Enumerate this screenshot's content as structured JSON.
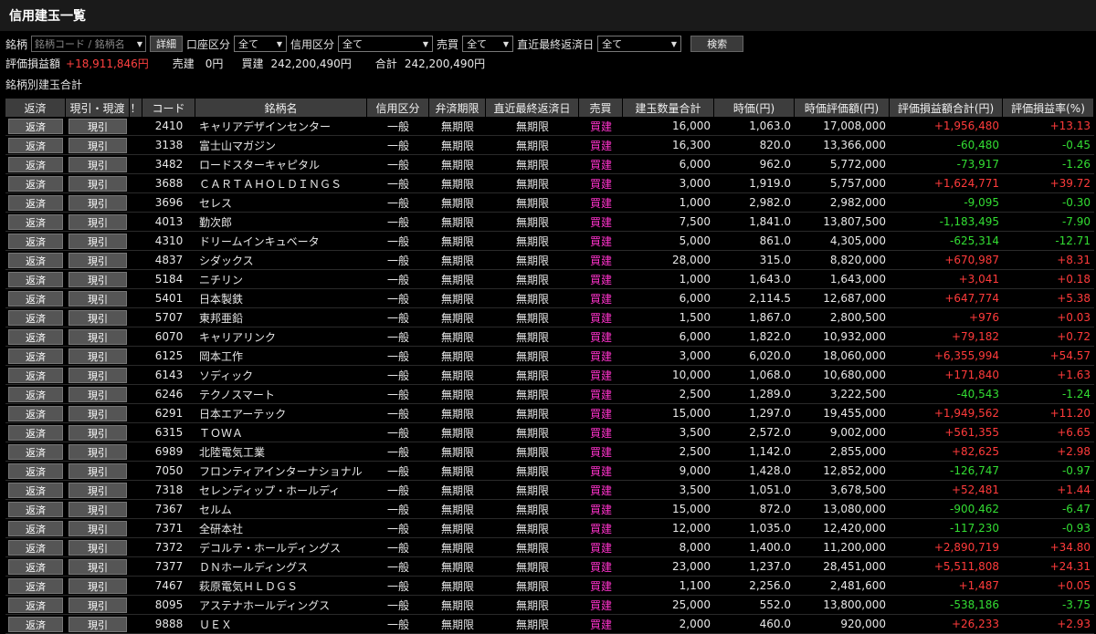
{
  "window": {
    "title": "信用建玉一覧"
  },
  "filters": {
    "meigara_label": "銘柄",
    "meigara_placeholder": "銘柄コード / 銘柄名",
    "detail_button": "詳細",
    "account_label": "口座区分",
    "account_value": "全て",
    "credit_label": "信用区分",
    "credit_value": "全て",
    "trade_label": "売買",
    "trade_value": "全て",
    "due_label": "直近最終返済日",
    "due_value": "全て",
    "search_button": "検索"
  },
  "summary": {
    "pl_label": "評価損益額",
    "pl_value": "+18,911,846円",
    "sell_label": "売建",
    "sell_value": "0円",
    "buy_label": "買建",
    "buy_value": "242,200,490円",
    "total_label": "合計",
    "total_value": "242,200,490円"
  },
  "section": {
    "title": "銘柄別建玉合計"
  },
  "table": {
    "headers": {
      "hensai": "返済",
      "genbiki": "現引・現渡",
      "mark": "！",
      "code": "コード",
      "name": "銘柄名",
      "kubun": "信用区分",
      "kigen": "弁済期限",
      "due": "直近最終返済日",
      "side": "売買",
      "qty": "建玉数量合計",
      "price": "時価(円)",
      "value": "時価評価額(円)",
      "pl": "評価損益額合計(円)",
      "rate": "評価損益率(%)"
    },
    "hensai_label": "返済",
    "genbiki_label": "現引",
    "rows": [
      {
        "code": "2410",
        "name": "キャリアデザインセンター",
        "kubun": "一般",
        "kigen": "無期限",
        "due": "無期限",
        "side": "買建",
        "qty": "16,000",
        "price": "1,063.0",
        "value": "17,008,000",
        "pl": "+1,956,480",
        "rate": "+13.13"
      },
      {
        "code": "3138",
        "name": "富士山マガジン",
        "kubun": "一般",
        "kigen": "無期限",
        "due": "無期限",
        "side": "買建",
        "qty": "16,300",
        "price": "820.0",
        "value": "13,366,000",
        "pl": "-60,480",
        "rate": "-0.45"
      },
      {
        "code": "3482",
        "name": "ロードスターキャピタル",
        "kubun": "一般",
        "kigen": "無期限",
        "due": "無期限",
        "side": "買建",
        "qty": "6,000",
        "price": "962.0",
        "value": "5,772,000",
        "pl": "-73,917",
        "rate": "-1.26"
      },
      {
        "code": "3688",
        "name": "ＣＡＲＴＡＨＯＬＤＩＮＧＳ",
        "kubun": "一般",
        "kigen": "無期限",
        "due": "無期限",
        "side": "買建",
        "qty": "3,000",
        "price": "1,919.0",
        "value": "5,757,000",
        "pl": "+1,624,771",
        "rate": "+39.72"
      },
      {
        "code": "3696",
        "name": "セレス",
        "kubun": "一般",
        "kigen": "無期限",
        "due": "無期限",
        "side": "買建",
        "qty": "1,000",
        "price": "2,982.0",
        "value": "2,982,000",
        "pl": "-9,095",
        "rate": "-0.30"
      },
      {
        "code": "4013",
        "name": "勤次郎",
        "kubun": "一般",
        "kigen": "無期限",
        "due": "無期限",
        "side": "買建",
        "qty": "7,500",
        "price": "1,841.0",
        "value": "13,807,500",
        "pl": "-1,183,495",
        "rate": "-7.90"
      },
      {
        "code": "4310",
        "name": "ドリームインキュベータ",
        "kubun": "一般",
        "kigen": "無期限",
        "due": "無期限",
        "side": "買建",
        "qty": "5,000",
        "price": "861.0",
        "value": "4,305,000",
        "pl": "-625,314",
        "rate": "-12.71"
      },
      {
        "code": "4837",
        "name": "シダックス",
        "kubun": "一般",
        "kigen": "無期限",
        "due": "無期限",
        "side": "買建",
        "qty": "28,000",
        "price": "315.0",
        "value": "8,820,000",
        "pl": "+670,987",
        "rate": "+8.31"
      },
      {
        "code": "5184",
        "name": "ニチリン",
        "kubun": "一般",
        "kigen": "無期限",
        "due": "無期限",
        "side": "買建",
        "qty": "1,000",
        "price": "1,643.0",
        "value": "1,643,000",
        "pl": "+3,041",
        "rate": "+0.18"
      },
      {
        "code": "5401",
        "name": "日本製鉄",
        "kubun": "一般",
        "kigen": "無期限",
        "due": "無期限",
        "side": "買建",
        "qty": "6,000",
        "price": "2,114.5",
        "value": "12,687,000",
        "pl": "+647,774",
        "rate": "+5.38"
      },
      {
        "code": "5707",
        "name": "東邦亜鉛",
        "kubun": "一般",
        "kigen": "無期限",
        "due": "無期限",
        "side": "買建",
        "qty": "1,500",
        "price": "1,867.0",
        "value": "2,800,500",
        "pl": "+976",
        "rate": "+0.03"
      },
      {
        "code": "6070",
        "name": "キャリアリンク",
        "kubun": "一般",
        "kigen": "無期限",
        "due": "無期限",
        "side": "買建",
        "qty": "6,000",
        "price": "1,822.0",
        "value": "10,932,000",
        "pl": "+79,182",
        "rate": "+0.72"
      },
      {
        "code": "6125",
        "name": "岡本工作",
        "kubun": "一般",
        "kigen": "無期限",
        "due": "無期限",
        "side": "買建",
        "qty": "3,000",
        "price": "6,020.0",
        "value": "18,060,000",
        "pl": "+6,355,994",
        "rate": "+54.57"
      },
      {
        "code": "6143",
        "name": "ソディック",
        "kubun": "一般",
        "kigen": "無期限",
        "due": "無期限",
        "side": "買建",
        "qty": "10,000",
        "price": "1,068.0",
        "value": "10,680,000",
        "pl": "+171,840",
        "rate": "+1.63"
      },
      {
        "code": "6246",
        "name": "テクノスマート",
        "kubun": "一般",
        "kigen": "無期限",
        "due": "無期限",
        "side": "買建",
        "qty": "2,500",
        "price": "1,289.0",
        "value": "3,222,500",
        "pl": "-40,543",
        "rate": "-1.24"
      },
      {
        "code": "6291",
        "name": "日本エアーテック",
        "kubun": "一般",
        "kigen": "無期限",
        "due": "無期限",
        "side": "買建",
        "qty": "15,000",
        "price": "1,297.0",
        "value": "19,455,000",
        "pl": "+1,949,562",
        "rate": "+11.20"
      },
      {
        "code": "6315",
        "name": "ＴＯＷＡ",
        "kubun": "一般",
        "kigen": "無期限",
        "due": "無期限",
        "side": "買建",
        "qty": "3,500",
        "price": "2,572.0",
        "value": "9,002,000",
        "pl": "+561,355",
        "rate": "+6.65"
      },
      {
        "code": "6989",
        "name": "北陸電気工業",
        "kubun": "一般",
        "kigen": "無期限",
        "due": "無期限",
        "side": "買建",
        "qty": "2,500",
        "price": "1,142.0",
        "value": "2,855,000",
        "pl": "+82,625",
        "rate": "+2.98"
      },
      {
        "code": "7050",
        "name": "フロンティアインターナショナル",
        "kubun": "一般",
        "kigen": "無期限",
        "due": "無期限",
        "side": "買建",
        "qty": "9,000",
        "price": "1,428.0",
        "value": "12,852,000",
        "pl": "-126,747",
        "rate": "-0.97"
      },
      {
        "code": "7318",
        "name": "セレンディップ・ホールディ",
        "kubun": "一般",
        "kigen": "無期限",
        "due": "無期限",
        "side": "買建",
        "qty": "3,500",
        "price": "1,051.0",
        "value": "3,678,500",
        "pl": "+52,481",
        "rate": "+1.44"
      },
      {
        "code": "7367",
        "name": "セルム",
        "kubun": "一般",
        "kigen": "無期限",
        "due": "無期限",
        "side": "買建",
        "qty": "15,000",
        "price": "872.0",
        "value": "13,080,000",
        "pl": "-900,462",
        "rate": "-6.47"
      },
      {
        "code": "7371",
        "name": "全研本社",
        "kubun": "一般",
        "kigen": "無期限",
        "due": "無期限",
        "side": "買建",
        "qty": "12,000",
        "price": "1,035.0",
        "value": "12,420,000",
        "pl": "-117,230",
        "rate": "-0.93"
      },
      {
        "code": "7372",
        "name": "デコルテ・ホールディングス",
        "kubun": "一般",
        "kigen": "無期限",
        "due": "無期限",
        "side": "買建",
        "qty": "8,000",
        "price": "1,400.0",
        "value": "11,200,000",
        "pl": "+2,890,719",
        "rate": "+34.80"
      },
      {
        "code": "7377",
        "name": "ＤＮホールディングス",
        "kubun": "一般",
        "kigen": "無期限",
        "due": "無期限",
        "side": "買建",
        "qty": "23,000",
        "price": "1,237.0",
        "value": "28,451,000",
        "pl": "+5,511,808",
        "rate": "+24.31"
      },
      {
        "code": "7467",
        "name": "萩原電気ＨＬＤＧＳ",
        "kubun": "一般",
        "kigen": "無期限",
        "due": "無期限",
        "side": "買建",
        "qty": "1,100",
        "price": "2,256.0",
        "value": "2,481,600",
        "pl": "+1,487",
        "rate": "+0.05"
      },
      {
        "code": "8095",
        "name": "アステナホールディングス",
        "kubun": "一般",
        "kigen": "無期限",
        "due": "無期限",
        "side": "買建",
        "qty": "25,000",
        "price": "552.0",
        "value": "13,800,000",
        "pl": "-538,186",
        "rate": "-3.75"
      },
      {
        "code": "9888",
        "name": "ＵＥＸ",
        "kubun": "一般",
        "kigen": "無期限",
        "due": "無期限",
        "side": "買建",
        "qty": "2,000",
        "price": "460.0",
        "value": "920,000",
        "pl": "+26,233",
        "rate": "+2.93"
      }
    ]
  },
  "colors": {
    "positive": "#ff3b3b",
    "negative": "#33dd33",
    "buy": "#ff33cc"
  }
}
